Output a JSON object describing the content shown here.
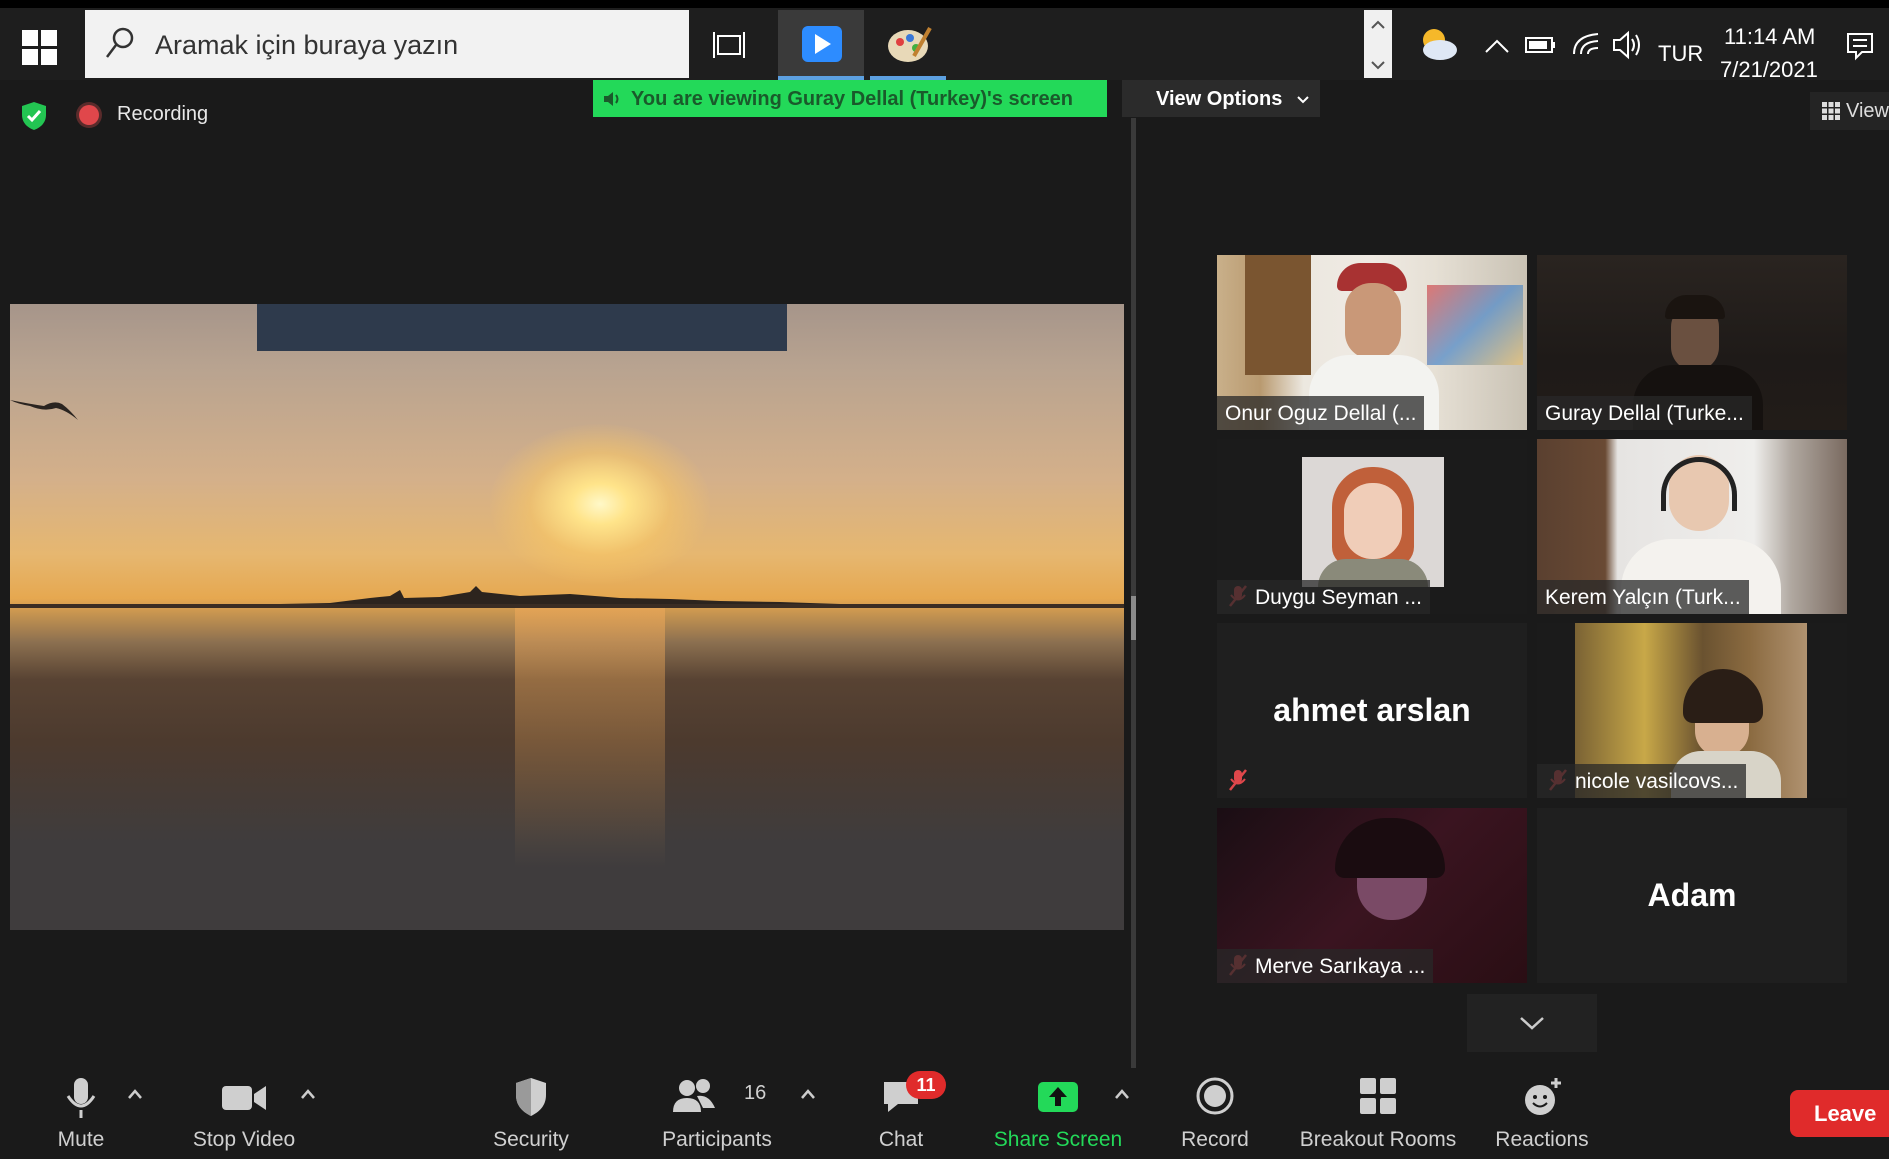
{
  "taskbar": {
    "search_placeholder": "Aramak için buraya yazın",
    "language": "TUR",
    "time": "11:14 AM",
    "date": "7/21/2021",
    "icons": [
      "windows-start-icon",
      "search-icon",
      "task-view-icon",
      "zoom-app-icon",
      "paint-app-icon",
      "weather-icon",
      "chevron-up-icon",
      "battery-icon",
      "wifi-icon",
      "volume-icon",
      "notifications-icon"
    ]
  },
  "meeting": {
    "recording_label": "Recording",
    "viewing_banner": "You are viewing Guray Dellal (Turkey)'s screen",
    "view_options_label": "View Options",
    "view_label": "View",
    "colors": {
      "banner": "#23d959",
      "record": "#e0474b",
      "leave": "#e02b2b",
      "share": "#23d959"
    }
  },
  "participants": [
    {
      "name": "Onur Oguz Dellal (...",
      "video": true,
      "muted": false
    },
    {
      "name": "Guray Dellal (Turke...",
      "video": true,
      "muted": false
    },
    {
      "name": "Duygu Seyman ...",
      "video": true,
      "muted": true
    },
    {
      "name": "Kerem Yalçın (Turk...",
      "video": true,
      "muted": false
    },
    {
      "name": "ahmet arslan",
      "video": false,
      "muted": true
    },
    {
      "name": "nicole vasilcovs...",
      "video": true,
      "muted": true
    },
    {
      "name": "Merve Sarıkaya ...",
      "video": true,
      "muted": true
    },
    {
      "name": "Adam",
      "video": false,
      "muted": false
    }
  ],
  "toolbar": {
    "mute": "Mute",
    "stop_video": "Stop Video",
    "security": "Security",
    "participants": "Participants",
    "participants_count": "16",
    "chat": "Chat",
    "chat_badge": "11",
    "share_screen": "Share Screen",
    "record": "Record",
    "breakout_rooms": "Breakout Rooms",
    "reactions": "Reactions",
    "leave": "Leave"
  }
}
